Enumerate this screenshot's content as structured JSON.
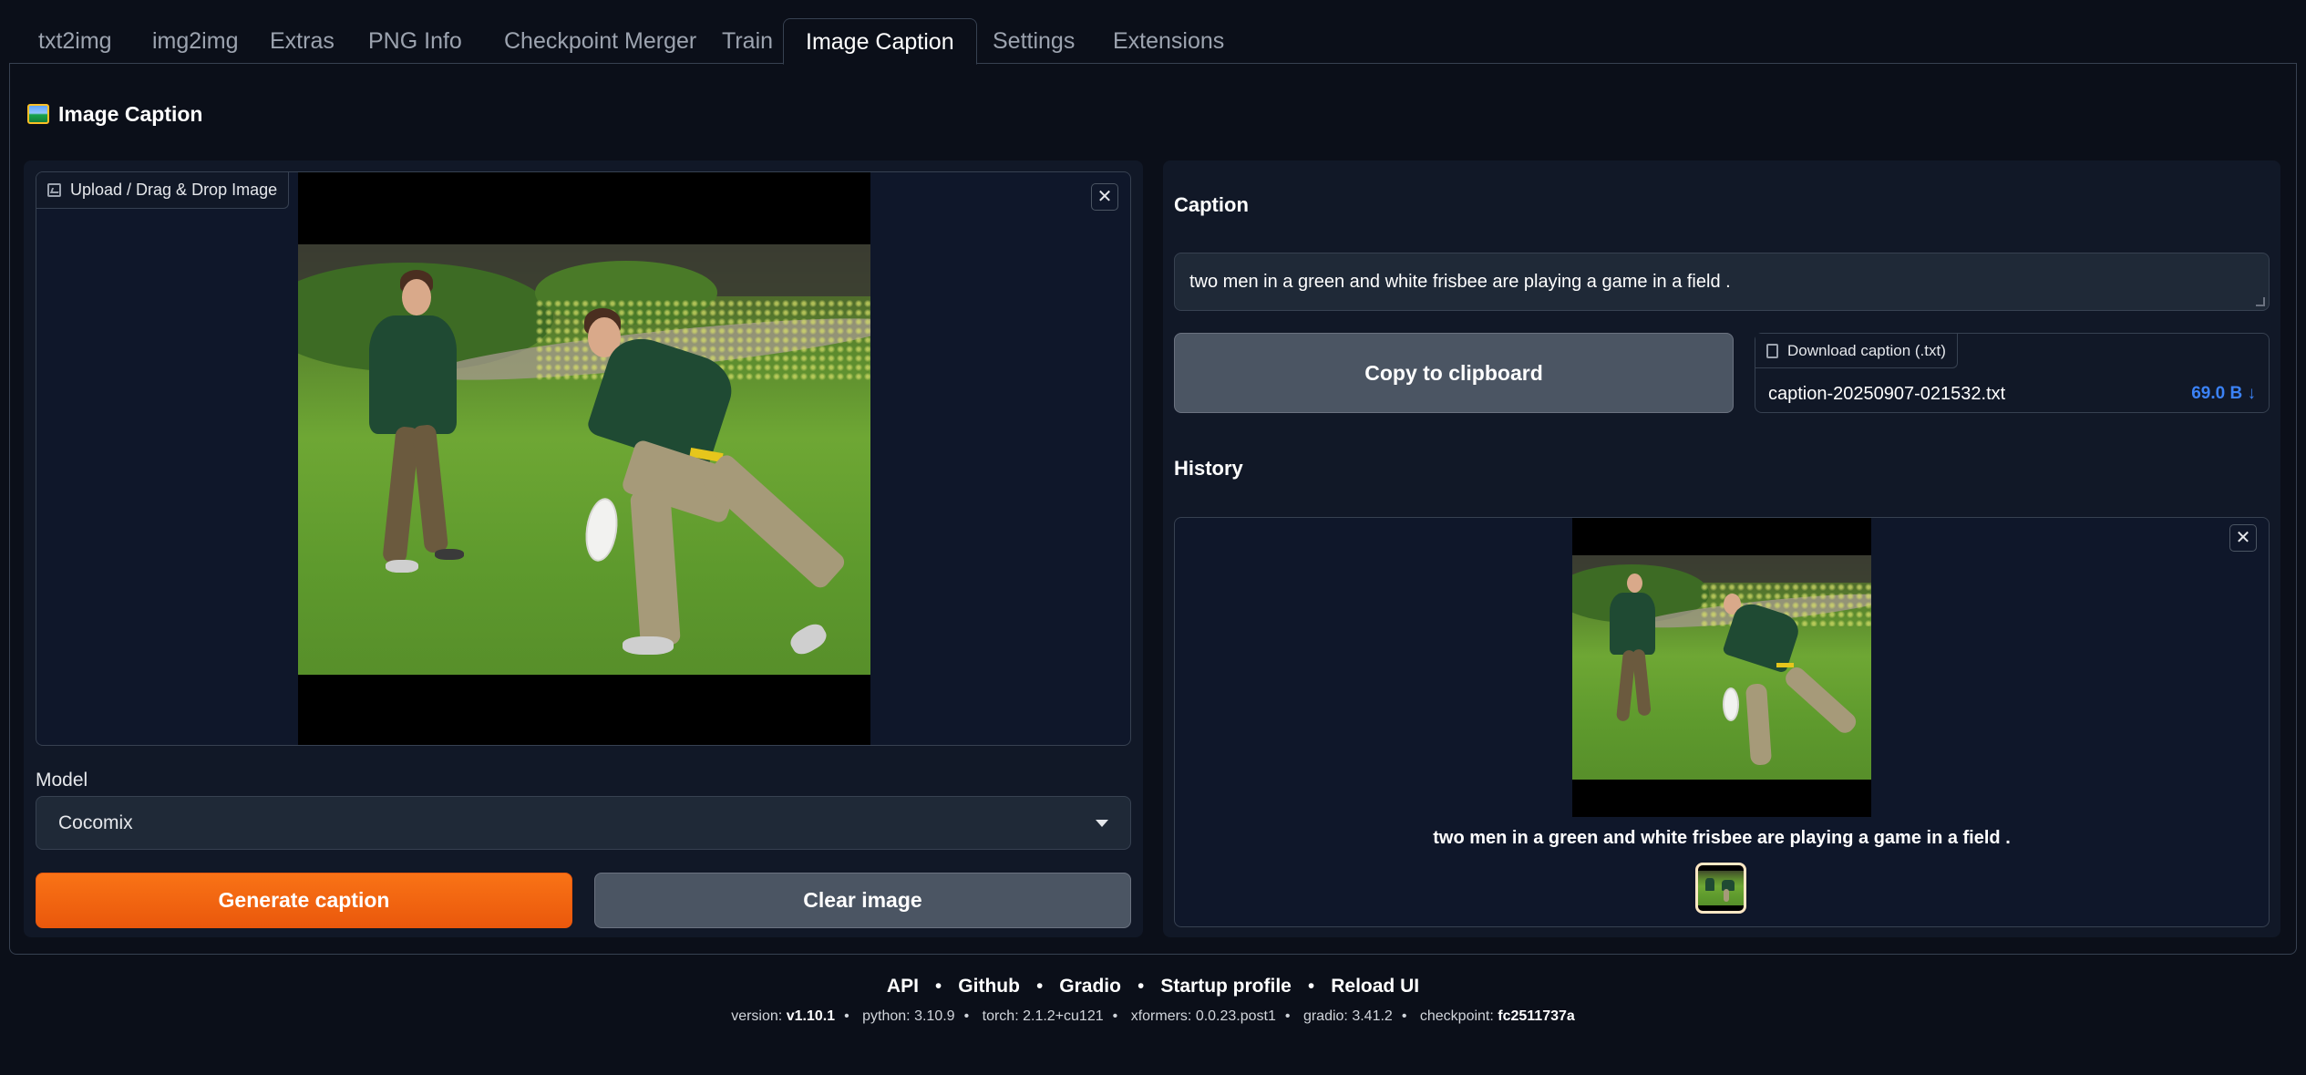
{
  "tabs": [
    {
      "label": "txt2img",
      "active": false
    },
    {
      "label": "img2img",
      "active": false
    },
    {
      "label": "Extras",
      "active": false
    },
    {
      "label": "PNG Info",
      "active": false
    },
    {
      "label": "Checkpoint Merger",
      "active": false
    },
    {
      "label": "Train",
      "active": false
    },
    {
      "label": "Image Caption",
      "active": true
    },
    {
      "label": "Settings",
      "active": false
    },
    {
      "label": "Extensions",
      "active": false
    }
  ],
  "page": {
    "title": "Image Caption",
    "title_icon": "framed-picture-icon"
  },
  "left": {
    "upload_label": "Upload / Drag & Drop Image",
    "model_label": "Model",
    "model_value": "Cocomix",
    "generate_label": "Generate caption",
    "clear_label": "Clear image"
  },
  "right": {
    "caption_title": "Caption",
    "caption_text": "two men in a green and white frisbee  are playing a game in a field .",
    "copy_label": "Copy to clipboard",
    "download_label": "Download caption (.txt)",
    "file_name": "caption-20250907-021532.txt",
    "file_size": "69.0 B ↓",
    "history_title": "History",
    "history_caption": "two men in a green and white frisbee are playing a game in a field ."
  },
  "footer": {
    "links": [
      "API",
      "Github",
      "Gradio",
      "Startup profile",
      "Reload UI"
    ],
    "version_label": "version:",
    "version": "v1.10.1",
    "python_label": "python:",
    "python": "3.10.9",
    "torch_label": "torch:",
    "torch": "2.1.2+cu121",
    "xformers_label": "xformers:",
    "xformers": "0.0.23.post1",
    "gradio_label": "gradio:",
    "gradio": "3.41.2",
    "checkpoint_label": "checkpoint:",
    "checkpoint": "fc2511737a"
  },
  "colors": {
    "background": "#0b0f19",
    "panel": "#111827",
    "primary_orange": "#f97316",
    "secondary_gray": "#4b5563",
    "link_blue": "#3b82f6"
  }
}
